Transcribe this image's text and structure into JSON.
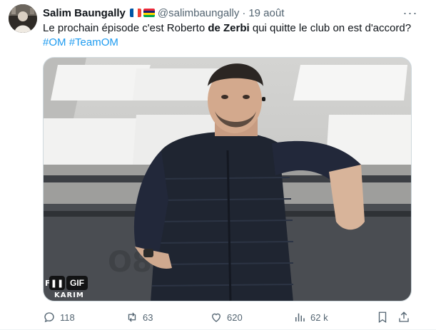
{
  "tweet": {
    "author_name": "Salim Baungally",
    "handle": "@salimbaungally",
    "separator": "·",
    "time": "19 août",
    "more_label": "···",
    "text_before": "Le prochain épisode c'est Roberto ",
    "text_bold": "de Zerbi",
    "text_after": " qui quitte le club on est d'accord? ",
    "hashtag_1": "#OM",
    "hashtag_2": "#TeamOM",
    "flags": [
      "france-flag",
      "mauritius-flag"
    ]
  },
  "media": {
    "type": "GIF",
    "pause_label": "❚❚",
    "badge_label": "GIF",
    "watermark_left": "F",
    "watermark_bottom": "KARIM"
  },
  "actions": {
    "replies": "118",
    "reposts": "63",
    "likes": "620",
    "views": "62 k"
  },
  "colors": {
    "link": "#1d9bf0",
    "secondary_text": "#536471",
    "primary_text": "#0f1419"
  }
}
